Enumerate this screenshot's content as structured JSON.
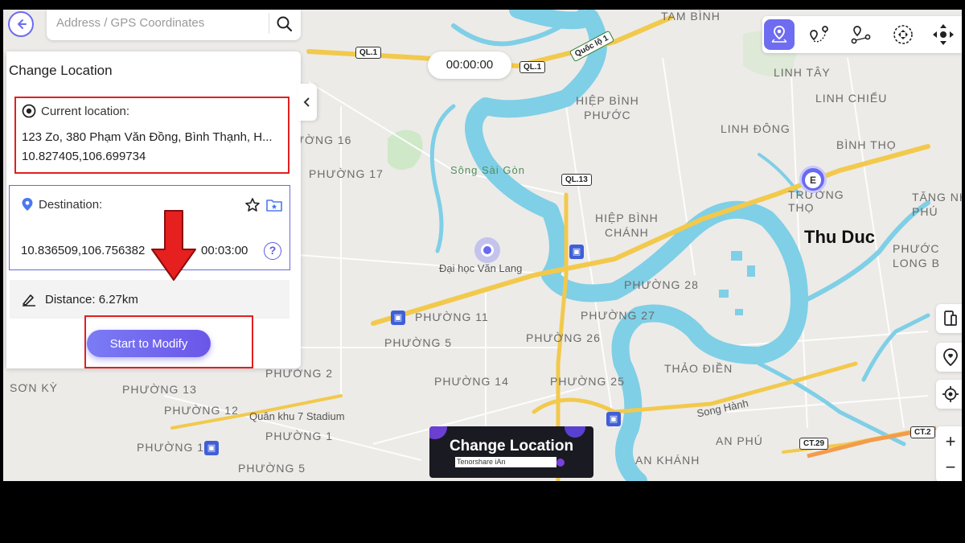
{
  "search": {
    "placeholder": "Address / GPS Coordinates"
  },
  "panel": {
    "title": "Change Location",
    "current": {
      "label": "Current location:",
      "address": "123 Zo, 380 Phạm Văn Đồng, Bình Thạnh, H...",
      "coords": "10.827405,106.699734"
    },
    "destination": {
      "label": "Destination:",
      "coords": "10.836509,106.756382",
      "time": "00:03:00"
    },
    "distance": "Distance: 6.27km",
    "start_button": "Start to Modify"
  },
  "timer": "00:00:00",
  "map": {
    "shields": [
      "QL.1",
      "QL.1",
      "Quốc lộ 1",
      "QL.13",
      "CT.29",
      "CT.2"
    ],
    "labels": {
      "tam_binh": "TAM BÌNH",
      "linh_tay": "LINH TÂY",
      "linh_chieu": "LINH CHIỂU",
      "hiep_binh_phuoc": "HIỆP BÌNH\nPHƯỚC",
      "linh_dong": "LINH ĐÔNG",
      "binh_tho": "BÌNH THỌ",
      "truong_tho": "TRƯỜNG\nTHỌ",
      "tang_nhon": "TĂNG NH\nPHÚ",
      "thu_duc": "Thu Duc",
      "phuoc_long_b": "PHƯỚC\nLONG B",
      "hiep_binh_chanh": "HIỆP BÌNH\nCHÁNH",
      "phuong_16": "ƯỜNG 16",
      "phuong_17": "PHƯỜNG 17",
      "song_sai_gon": "Sông Sài Gòn",
      "dai_hoc": "Đại học Văn Lang",
      "phuong_28": "PHƯỜNG 28",
      "phuong_11": "PHƯỜNG 11",
      "phuong_27": "PHƯỜNG 27",
      "phuong_5": "PHƯỜNG 5",
      "phuong_26": "PHƯỜNG 26",
      "phuong_2": "PHƯỜNG 2",
      "phuong_14": "PHƯỜNG 14",
      "phuong_25": "PHƯỜNG 25",
      "thao_dien": "THẢO ĐIỀN",
      "son_ky": "SƠN KỲ",
      "phuong_13": "PHƯỜNG 13",
      "phuong_12": "PHƯỜNG 12",
      "quan_khu": "Quân khu 7 Stadium",
      "phuong_1": "PHƯỜNG 1",
      "song_hanh": "Song Hành",
      "an_phu": "AN PHÚ",
      "phuong_14b": "PHƯỜNG 14",
      "phuong_5b": "PHƯỜNG 5",
      "an_khanh": "AN KHÁNH"
    },
    "end_marker": "E"
  },
  "banner": {
    "title": "Change Location",
    "subtitle": "Tenorshare iAn"
  },
  "colors": {
    "accent": "#6e6cf0",
    "highlight": "#e02020",
    "water": "#7fcfe6",
    "road": "#f2c94c"
  }
}
